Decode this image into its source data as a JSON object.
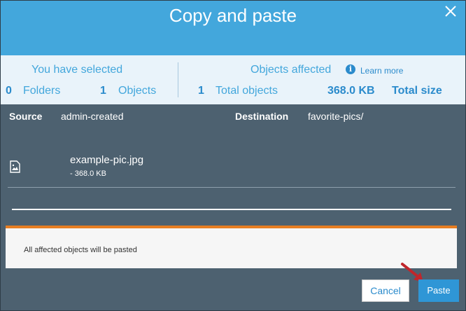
{
  "header": {
    "title": "Copy and paste"
  },
  "summary": {
    "selected_heading": "You have selected",
    "folders_count": "0",
    "folders_label": "Folders",
    "objects_count": "1",
    "objects_label": "Objects",
    "affected_heading": "Objects affected",
    "learn_more": "Learn more",
    "total_objects_count": "1",
    "total_objects_label": "Total objects",
    "total_size_value": "368.0 KB",
    "total_size_label": "Total size"
  },
  "transfer": {
    "source_label": "Source",
    "source_value": "admin-created",
    "destination_label": "Destination",
    "destination_value": "favorite-pics/"
  },
  "files": [
    {
      "name": "example-pic.jpg",
      "size": "- 368.0 KB"
    }
  ],
  "notice": {
    "text": "All affected objects will be pasted"
  },
  "buttons": {
    "cancel": "Cancel",
    "paste": "Paste"
  },
  "colors": {
    "header": "#43a7dc",
    "summary_bg": "#e9f3fa",
    "body_bg": "#4d6170",
    "notice_accent": "#e67e22",
    "primary_button": "#2f96d6"
  }
}
